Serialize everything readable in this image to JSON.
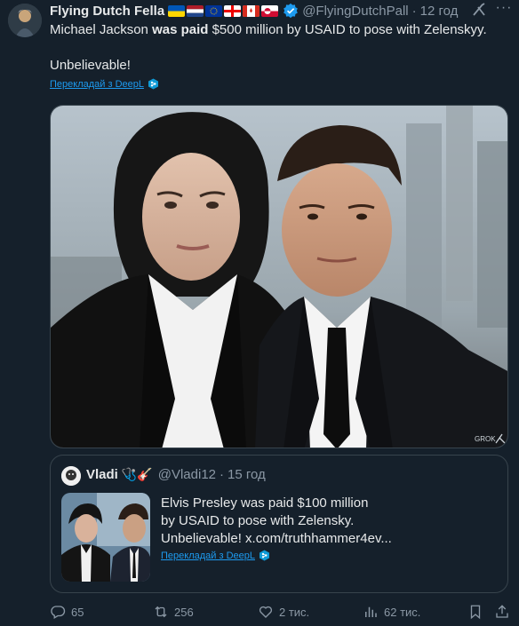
{
  "author": {
    "display_name": "Flying Dutch Fella",
    "handle": "@FlyingDutchPall",
    "separator": "·",
    "time": "12 год"
  },
  "tweet": {
    "text_pre": "Michael Jackson ",
    "text_bold": "was paid",
    "text_post": " $500 million by USAID to pose with Zelenskyy.",
    "text_line2": "Unbelievable!",
    "translate_label": "Перекладай з DeepL"
  },
  "media": {
    "watermark": "GROK"
  },
  "quote": {
    "display_name": "Vladi",
    "emoji": "🩺🎸",
    "handle": "@Vladi12",
    "separator": "·",
    "time": "15 год",
    "text_line1": "Elvis Presley was paid $100 million",
    "text_line2": "by USAID to pose with Zelensky.",
    "text_line3": "Unbelievable!  x.com/truthhammer4ev...",
    "translate_label": "Перекладай з DeepL"
  },
  "actions": {
    "reply_count": "65",
    "retweet_count": "256",
    "like_count": "2 тис.",
    "view_count": "62 тис."
  },
  "colors": {
    "background": "#15202b",
    "text": "#e7e9ea",
    "muted": "#8b98a5",
    "link": "#1d9bf0",
    "border": "#38444d"
  }
}
